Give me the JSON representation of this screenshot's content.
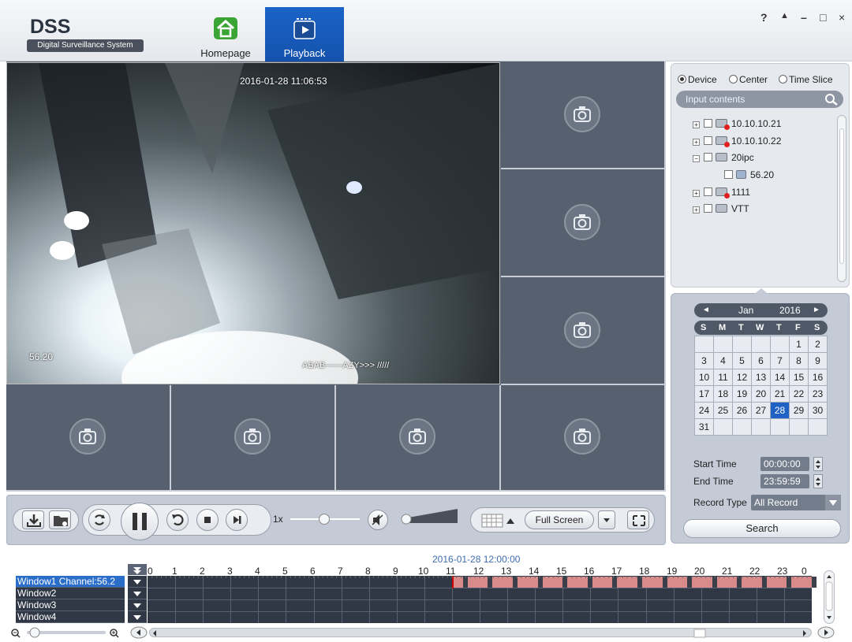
{
  "app": {
    "title": "DSS",
    "subtitle": "Digital Surveillance System",
    "tabs": [
      {
        "label": "Homepage"
      },
      {
        "label": "Playback"
      }
    ],
    "window_controls": {
      "help": "?",
      "lock": "▲",
      "minimize": "–",
      "maximize": "□",
      "close": "×"
    }
  },
  "video": {
    "timestamp": "2016-01-28 11:06:53",
    "channel_label": "56.20",
    "overlay_text": "ABAB——AZY>>> /////",
    "empty_icon": "camera-disabled-icon"
  },
  "device_panel": {
    "modes": [
      "Device",
      "Center",
      "Time Slice"
    ],
    "selected_mode": "Device",
    "search_placeholder": "Input contents",
    "tree": [
      {
        "label": "10.10.10.21",
        "expand": "+",
        "status": "offline"
      },
      {
        "label": "10.10.10.22",
        "expand": "+",
        "status": "offline"
      },
      {
        "label": "20ipc",
        "expand": "−",
        "status": "online"
      },
      {
        "label": "56.20",
        "expand": "",
        "status": "camera"
      },
      {
        "label": "1111",
        "expand": "+",
        "status": "offline"
      },
      {
        "label": "VTT",
        "expand": "+",
        "status": "online"
      }
    ]
  },
  "calendar": {
    "prev": "◄",
    "month": "Jan",
    "year": "2016",
    "next": "►",
    "weekdays": [
      "S",
      "M",
      "T",
      "W",
      "T",
      "F",
      "S"
    ],
    "weeks": [
      [
        "",
        "",
        "",
        "",
        "",
        "1",
        "2"
      ],
      [
        "3",
        "4",
        "5",
        "6",
        "7",
        "8",
        "9"
      ],
      [
        "10",
        "11",
        "12",
        "13",
        "14",
        "15",
        "16"
      ],
      [
        "17",
        "18",
        "19",
        "20",
        "21",
        "22",
        "23"
      ],
      [
        "24",
        "25",
        "26",
        "27",
        "28",
        "29",
        "30"
      ],
      [
        "31",
        "",
        "",
        "",
        "",
        "",
        ""
      ]
    ],
    "selected_day": "28",
    "start_time_label": "Start Time",
    "start_time": "00:00:00",
    "end_time_label": "End Time",
    "end_time": "23:59:59",
    "record_type_label": "Record Type",
    "record_type": "All Record",
    "search_label": "Search"
  },
  "toolbar": {
    "speed": "1x",
    "fullscreen_label": "Full Screen",
    "playback_progress": 0.47,
    "volume": 0.0
  },
  "timeline": {
    "center_time": "2016-01-28 12:00:00",
    "hours": [
      "0",
      "1",
      "2",
      "3",
      "4",
      "5",
      "6",
      "7",
      "8",
      "9",
      "10",
      "11",
      "12",
      "13",
      "14",
      "15",
      "16",
      "17",
      "18",
      "19",
      "20",
      "21",
      "22",
      "23",
      "0"
    ],
    "windows": [
      "Window1 Channel:56.2",
      "Window2",
      "Window3",
      "Window4"
    ],
    "record_range_hours": [
      11.0,
      24.0
    ],
    "record_color": "#d98b8b",
    "selected_window_color": "#2b6ec9"
  },
  "colors": {
    "accent": "#1a5fc4",
    "panel": "#c4cad6",
    "video_bg": "#56606f"
  }
}
